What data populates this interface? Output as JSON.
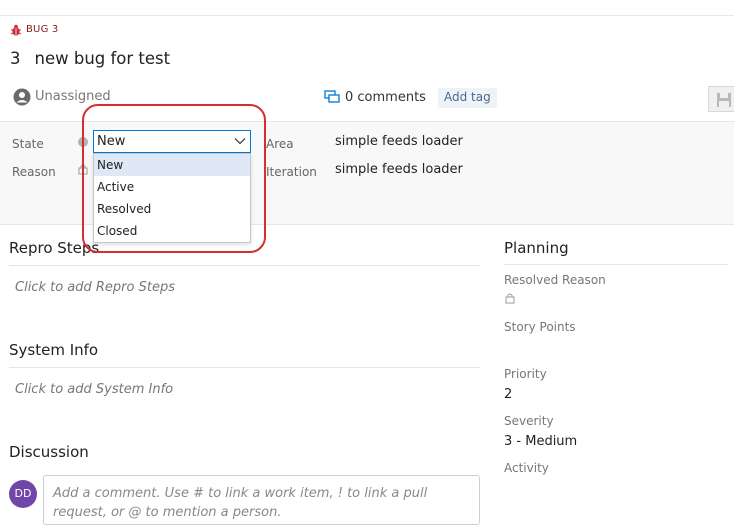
{
  "work_item": {
    "type_label": "BUG 3",
    "id": "3",
    "title": "new bug for test",
    "assignee": "Unassigned",
    "comments": "0 comments",
    "add_tag": "Add tag"
  },
  "fields": {
    "state_label": "State",
    "state_value": "New",
    "reason_label": "Reason",
    "area_label": "Area",
    "area_value": "simple feeds loader",
    "iteration_label": "Iteration",
    "iteration_value": "simple feeds loader"
  },
  "state_options": [
    "New",
    "Active",
    "Resolved",
    "Closed"
  ],
  "sections": {
    "repro_title": "Repro Steps",
    "repro_placeholder": "Click to add Repro Steps",
    "system_title": "System Info",
    "system_placeholder": "Click to add System Info",
    "discussion_title": "Discussion"
  },
  "planning": {
    "title": "Planning",
    "resolved_reason_label": "Resolved Reason",
    "story_points_label": "Story Points",
    "priority_label": "Priority",
    "priority_value": "2",
    "severity_label": "Severity",
    "severity_value": "3 - Medium",
    "activity_label": "Activity"
  },
  "discussion": {
    "avatar_initials": "DD",
    "comment_placeholder": "Add a comment. Use # to link a work item, ! to link a pull request, or @ to mention a person."
  },
  "colors": {
    "accent": "#0078d4",
    "bug": "#cc293d",
    "highlight": "#d32f2f",
    "avatar": "#7047a8"
  }
}
